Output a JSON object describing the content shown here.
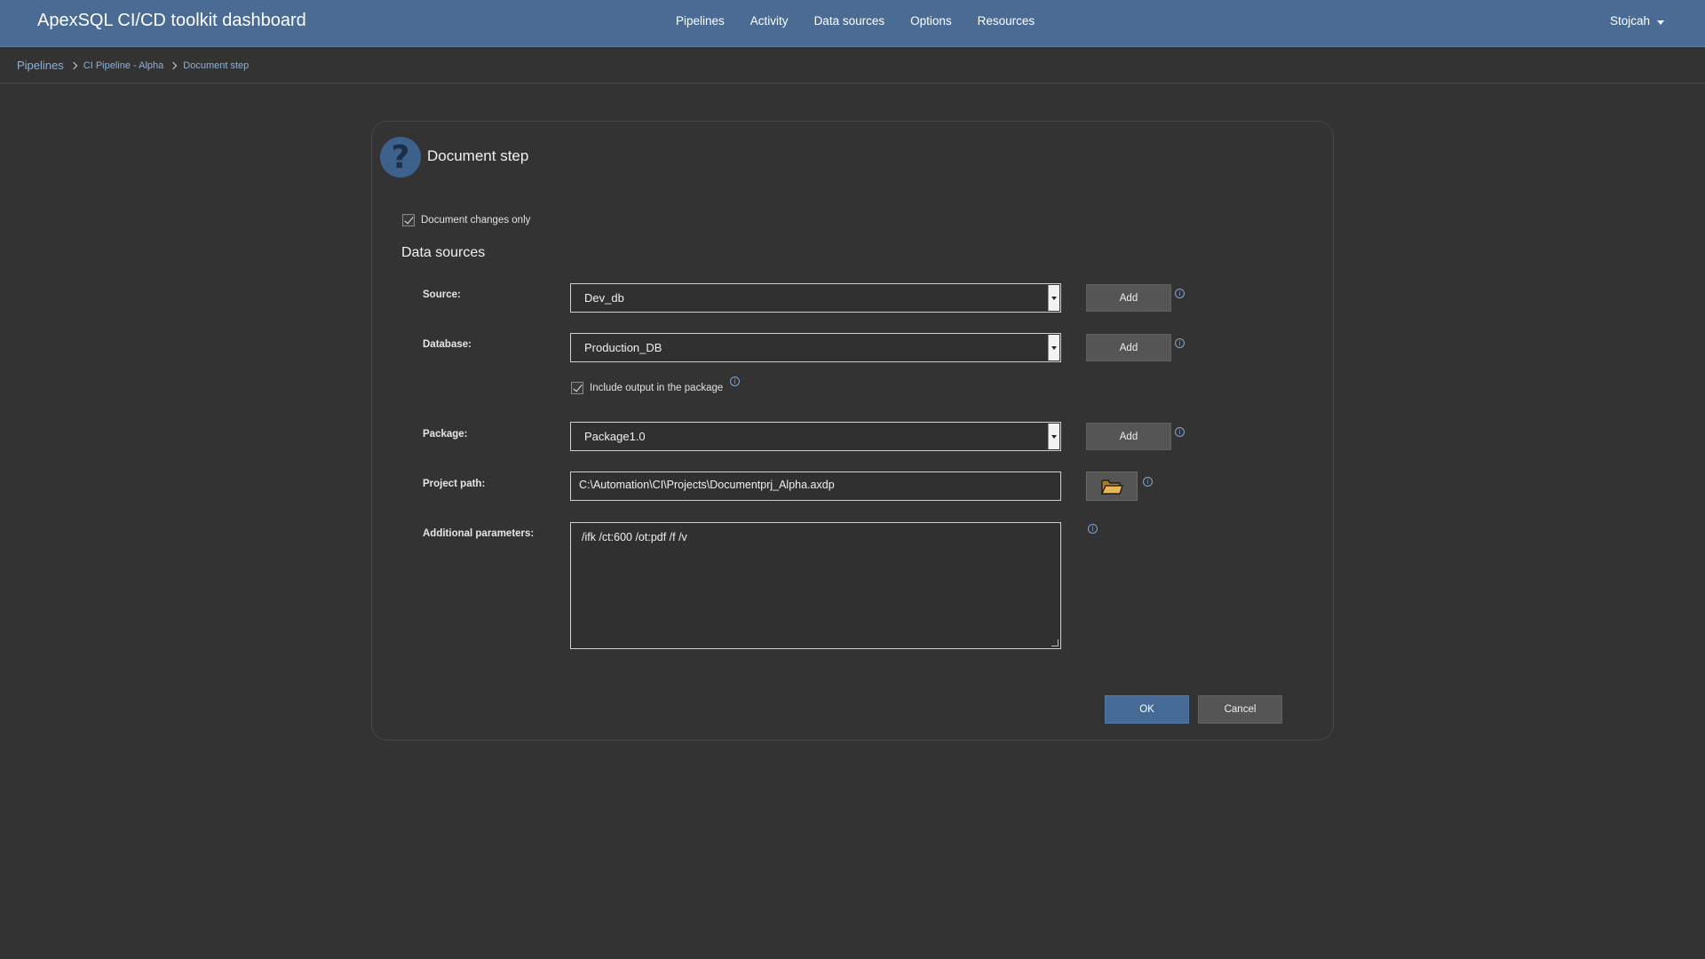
{
  "app": {
    "title": "ApexSQL CI/CD toolkit dashboard"
  },
  "nav": {
    "items": [
      {
        "label": "Pipelines"
      },
      {
        "label": "Activity"
      },
      {
        "label": "Data sources"
      },
      {
        "label": "Options"
      },
      {
        "label": "Resources"
      }
    ],
    "user": "Stojcah"
  },
  "breadcrumb": {
    "items": [
      {
        "label": "Pipelines"
      },
      {
        "label": "CI Pipeline - Alpha"
      },
      {
        "label": "Document step"
      }
    ]
  },
  "dialog": {
    "title": "Document step",
    "help_icon_glyph": "?",
    "document_changes_only": {
      "label": "Document changes only",
      "checked": true
    },
    "section_title": "Data sources",
    "source": {
      "label": "Source:",
      "value": "Dev_db",
      "add_label": "Add"
    },
    "database": {
      "label": "Database:",
      "value": "Production_DB",
      "add_label": "Add"
    },
    "include_output": {
      "label": "Include output in the package",
      "checked": true
    },
    "package": {
      "label": "Package:",
      "value": "Package1.0",
      "add_label": "Add"
    },
    "project_path": {
      "label": "Project path:",
      "value": "C:\\Automation\\CI\\Projects\\Documentprj_Alpha.axdp"
    },
    "additional_parameters": {
      "label": "Additional parameters:",
      "value": "/ifk /ct:600 /ot:pdf /f /v"
    },
    "info_glyph": "i",
    "ok_label": "OK",
    "cancel_label": "Cancel"
  },
  "colors": {
    "topbar": "#4a6b94",
    "background": "#333333",
    "accent_button": "#456a96",
    "link": "#8fb0d8"
  }
}
